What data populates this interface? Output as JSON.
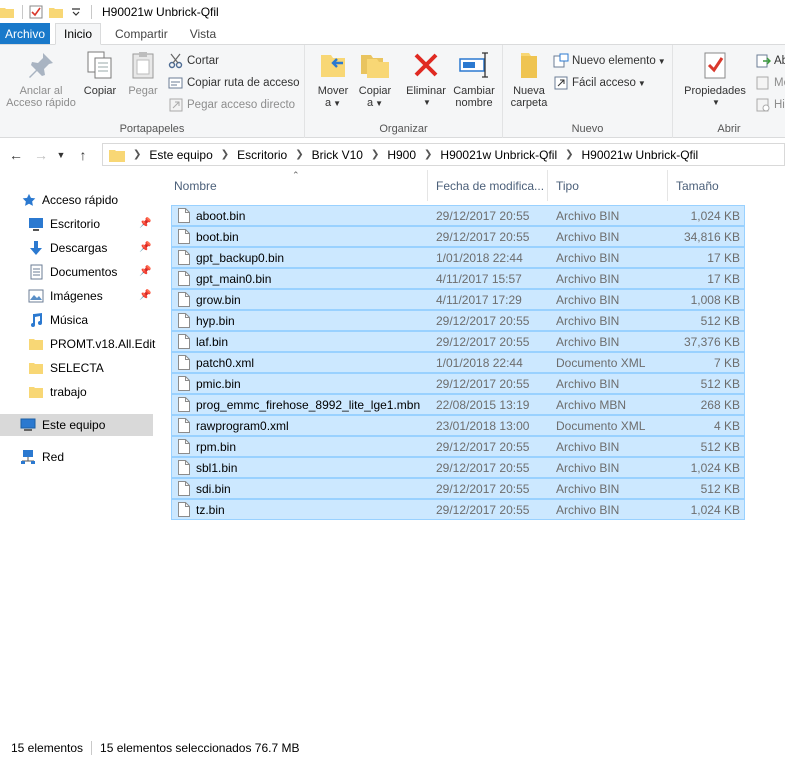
{
  "window": {
    "title": "H90021w Unbrick-Qfil"
  },
  "tabs": [
    {
      "label": "Archivo"
    },
    {
      "label": "Inicio"
    },
    {
      "label": "Compartir"
    },
    {
      "label": "Vista"
    }
  ],
  "ribbon": {
    "portapapeles": {
      "label": "Portapapeles",
      "pin_quick": "Anclar al",
      "pin_quick2": "Acceso rápido",
      "copy": "Copiar",
      "paste": "Pegar",
      "cut": "Cortar",
      "copy_path": "Copiar ruta de acceso",
      "paste_shortcut": "Pegar acceso directo"
    },
    "organizar": {
      "label": "Organizar",
      "move": "Mover",
      "move2": "a",
      "copyto": "Copiar",
      "copyto2": "a",
      "delete": "Eliminar",
      "rename": "Cambiar",
      "rename2": "nombre"
    },
    "nuevo": {
      "label": "Nuevo",
      "new_folder": "Nueva",
      "new_folder2": "carpeta",
      "new_item": "Nuevo elemento",
      "easy_access": "Fácil acceso"
    },
    "abrir": {
      "label": "Abrir",
      "properties": "Propiedades",
      "open": "Ab",
      "modify": "Mo",
      "history": "His"
    }
  },
  "address": {
    "crumbs": [
      "Este equipo",
      "Escritorio",
      "Brick V10",
      "H900",
      "H90021w Unbrick-Qfil",
      "H90021w Unbrick-Qfil"
    ]
  },
  "navpane": {
    "quick_access": "Acceso rápido",
    "items": [
      {
        "label": "Escritorio",
        "icon": "desktop-icon"
      },
      {
        "label": "Descargas",
        "icon": "download-icon"
      },
      {
        "label": "Documentos",
        "icon": "documents-icon"
      },
      {
        "label": "Imágenes",
        "icon": "pictures-icon"
      },
      {
        "label": "Música",
        "icon": "music-icon"
      },
      {
        "label": "PROMT.v18.All.Edit",
        "icon": "folder-icon"
      },
      {
        "label": "SELECTA",
        "icon": "folder-icon"
      },
      {
        "label": "trabajo",
        "icon": "folder-icon"
      }
    ],
    "this_pc": "Este equipo",
    "network": "Red"
  },
  "columns": {
    "name": "Nombre",
    "date": "Fecha de modifica...",
    "type": "Tipo",
    "size": "Tamaño"
  },
  "files": [
    {
      "name": "aboot.bin",
      "date": "29/12/2017 20:55",
      "type": "Archivo BIN",
      "size": "1,024 KB"
    },
    {
      "name": "boot.bin",
      "date": "29/12/2017 20:55",
      "type": "Archivo BIN",
      "size": "34,816 KB"
    },
    {
      "name": "gpt_backup0.bin",
      "date": "1/01/2018 22:44",
      "type": "Archivo BIN",
      "size": "17 KB"
    },
    {
      "name": "gpt_main0.bin",
      "date": "4/11/2017 15:57",
      "type": "Archivo BIN",
      "size": "17 KB"
    },
    {
      "name": "grow.bin",
      "date": "4/11/2017 17:29",
      "type": "Archivo BIN",
      "size": "1,008 KB"
    },
    {
      "name": "hyp.bin",
      "date": "29/12/2017 20:55",
      "type": "Archivo BIN",
      "size": "512 KB"
    },
    {
      "name": "laf.bin",
      "date": "29/12/2017 20:55",
      "type": "Archivo BIN",
      "size": "37,376 KB"
    },
    {
      "name": "patch0.xml",
      "date": "1/01/2018 22:44",
      "type": "Documento XML",
      "size": "7 KB"
    },
    {
      "name": "pmic.bin",
      "date": "29/12/2017 20:55",
      "type": "Archivo BIN",
      "size": "512 KB"
    },
    {
      "name": "prog_emmc_firehose_8992_lite_lge1.mbn",
      "date": "22/08/2015 13:19",
      "type": "Archivo MBN",
      "size": "268 KB"
    },
    {
      "name": "rawprogram0.xml",
      "date": "23/01/2018 13:00",
      "type": "Documento XML",
      "size": "4 KB"
    },
    {
      "name": "rpm.bin",
      "date": "29/12/2017 20:55",
      "type": "Archivo BIN",
      "size": "512 KB"
    },
    {
      "name": "sbl1.bin",
      "date": "29/12/2017 20:55",
      "type": "Archivo BIN",
      "size": "1,024 KB"
    },
    {
      "name": "sdi.bin",
      "date": "29/12/2017 20:55",
      "type": "Archivo BIN",
      "size": "512 KB"
    },
    {
      "name": "tz.bin",
      "date": "29/12/2017 20:55",
      "type": "Archivo BIN",
      "size": "1,024 KB"
    }
  ],
  "status": {
    "count": "15 elementos",
    "selected": "15 elementos seleccionados  76.7 MB"
  },
  "colors": {
    "selection_bg": "#cce8ff",
    "selection_border": "#99d1ff",
    "file_tab": "#1979ca"
  }
}
